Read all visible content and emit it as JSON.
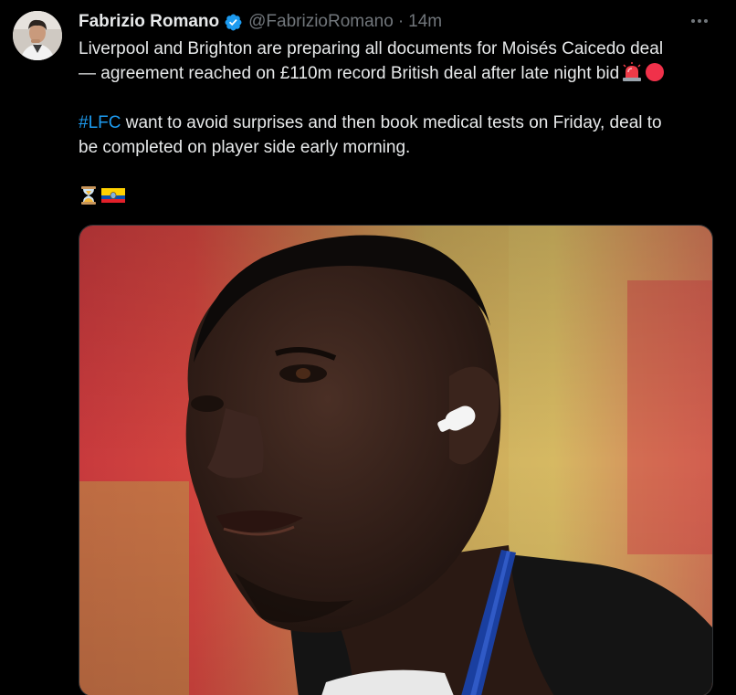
{
  "author": {
    "display_name": "Fabrizio Romano",
    "handle": "@FabrizioRomano",
    "separator": "·",
    "timestamp": "14m",
    "verified": true,
    "verified_color": "#1d9bf0"
  },
  "tweet": {
    "line1": "Liverpool and Brighton are preparing all documents for Moisés Caicedo deal",
    "line2": "— agreement reached on £110m record British deal after late night bid",
    "line2_emojis": [
      "rotating-light-emoji",
      "red-circle-emoji"
    ],
    "hashtag": "#LFC",
    "line3_rest": " want to avoid surprises and then book medical tests on Friday, deal to",
    "line4": "be completed on player side early morning.",
    "line5_emojis": [
      "hourglass-emoji",
      "ecuador-flag-emoji"
    ]
  },
  "media": {
    "type": "photo",
    "subject": "football player wearing a white earbud"
  },
  "icons": {
    "more": "more-dots-icon",
    "verified": "verified-badge-icon"
  },
  "colors": {
    "background": "#000000",
    "text": "#e7e9ea",
    "muted": "#71767b",
    "link": "#1d9bf0"
  }
}
